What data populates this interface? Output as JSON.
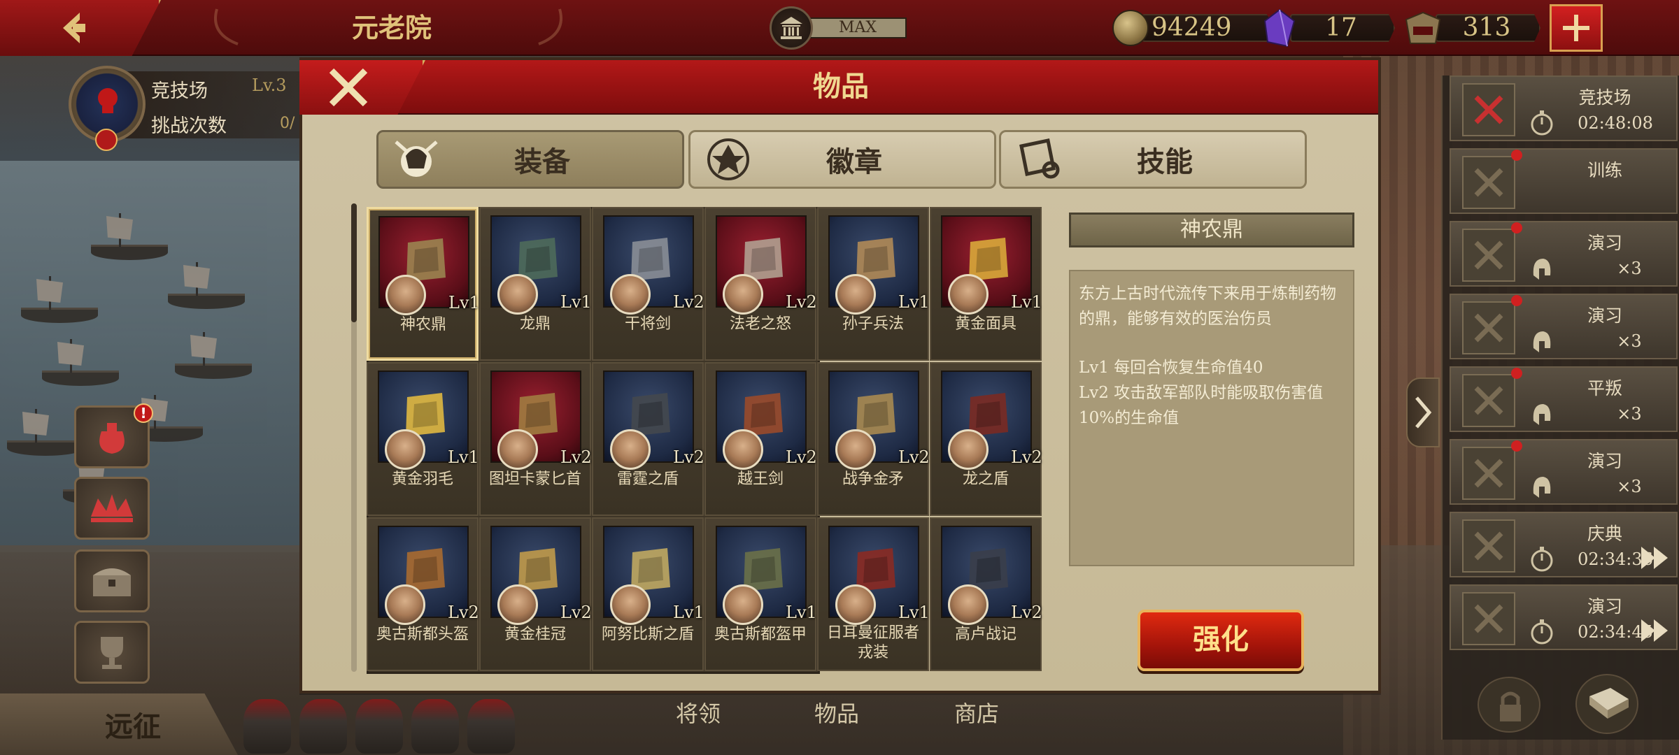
{
  "header": {
    "title": "元老院",
    "senate_level": "MAX",
    "gold": "94249",
    "gems": "17",
    "spqr": "313"
  },
  "arena_card": {
    "name": "竞技场",
    "level": "Lv.3",
    "challenge_label": "挑战次数",
    "challenge_count": "0/",
    "badge": "!"
  },
  "left_menu": {
    "bag_badge": "!",
    "expedition": "远征"
  },
  "bottom_tabs": [
    "将领",
    "物品",
    "商店"
  ],
  "modal": {
    "title": "物品",
    "tabs": [
      {
        "label": "装备",
        "icon": "helmet-shield-icon",
        "active": true
      },
      {
        "label": "徽章",
        "icon": "eagle-emblem-icon",
        "active": false
      },
      {
        "label": "技能",
        "icon": "scroll-icon",
        "active": false
      }
    ],
    "items": [
      {
        "name": "神农鼎",
        "level": "Lv1",
        "icon": "cauldron-icon",
        "bg": "red"
      },
      {
        "name": "龙鼎",
        "level": "Lv1",
        "icon": "bronze-vessel-icon",
        "bg": "blue"
      },
      {
        "name": "干将剑",
        "level": "Lv2",
        "icon": "sword-icon",
        "bg": "blue"
      },
      {
        "name": "法老之怒",
        "level": "Lv2",
        "icon": "axe-icon",
        "bg": "red"
      },
      {
        "name": "孙子兵法",
        "level": "Lv1",
        "icon": "bamboo-scroll-icon",
        "bg": "blue"
      },
      {
        "name": "黄金面具",
        "level": "Lv1",
        "icon": "pharaoh-mask-icon",
        "bg": "red"
      },
      {
        "name": "黄金羽毛",
        "level": "Lv1",
        "icon": "golden-wing-icon",
        "bg": "blue"
      },
      {
        "name": "图坦卡蒙匕首",
        "level": "Lv2",
        "icon": "dagger-icon",
        "bg": "red"
      },
      {
        "name": "雷霆之盾",
        "level": "Lv2",
        "icon": "shield-icon",
        "bg": "blue"
      },
      {
        "name": "越王剑",
        "level": "Lv2",
        "icon": "bronze-sword-icon",
        "bg": "blue"
      },
      {
        "name": "战争金矛",
        "level": "Lv2",
        "icon": "spear-icon",
        "bg": "blue"
      },
      {
        "name": "龙之盾",
        "level": "Lv2",
        "icon": "dragon-shield-icon",
        "bg": "blue"
      },
      {
        "name": "奥古斯都头盔",
        "level": "Lv2",
        "icon": "plumed-helmet-icon",
        "bg": "blue"
      },
      {
        "name": "黄金桂冠",
        "level": "Lv2",
        "icon": "laurel-wreath-icon",
        "bg": "blue"
      },
      {
        "name": "阿努比斯之盾",
        "level": "Lv1",
        "icon": "oval-shield-icon",
        "bg": "blue"
      },
      {
        "name": "奥古斯都盔甲",
        "level": "Lv1",
        "icon": "armor-icon",
        "bg": "blue"
      },
      {
        "name": "日耳曼征服者戎装",
        "level": "Lv1",
        "icon": "cuirass-icon",
        "bg": "blue"
      },
      {
        "name": "高卢战记",
        "level": "Lv2",
        "icon": "book-icon",
        "bg": "blue"
      }
    ],
    "detail": {
      "title": "神农鼎",
      "description": "东方上古时代流传下来用于炼制药物的鼎，能够有效的医治伤员",
      "lv1": "Lv1 每回合恢复生命值40",
      "lv2": "Lv2 攻击敌军部队时能吸取伤害值10%的生命值"
    },
    "enhance_label": "强化"
  },
  "quests": [
    {
      "title": "竞技场",
      "sub": "02:48:08",
      "icon": "crossed-swords-icon",
      "dot": false,
      "kind": "timer"
    },
    {
      "title": "训练",
      "sub": "",
      "icon": "spartan-helmet-icon",
      "dot": true,
      "kind": "plain"
    },
    {
      "title": "演习",
      "sub": "×3",
      "icon": "battle-icon",
      "dot": true,
      "kind": "helmet"
    },
    {
      "title": "演习",
      "sub": "×3",
      "icon": "battle-icon",
      "dot": true,
      "kind": "helmet"
    },
    {
      "title": "平叛",
      "sub": "×3",
      "icon": "gladiator-helmet-icon",
      "dot": true,
      "kind": "helmet"
    },
    {
      "title": "演习",
      "sub": "×3",
      "icon": "battle-icon",
      "dot": true,
      "kind": "helmet"
    },
    {
      "title": "庆典",
      "sub": "02:34:36",
      "icon": "temple-icon",
      "dot": false,
      "kind": "timer-ff"
    },
    {
      "title": "演习",
      "sub": "02:34:45",
      "icon": "battle-icon",
      "dot": false,
      "kind": "timer-ff"
    }
  ],
  "colors": {
    "banner_red": "#b31818",
    "parchment": "#cfc3a4",
    "gold_text": "#f0d890",
    "enhance_red": "#e02a10"
  }
}
